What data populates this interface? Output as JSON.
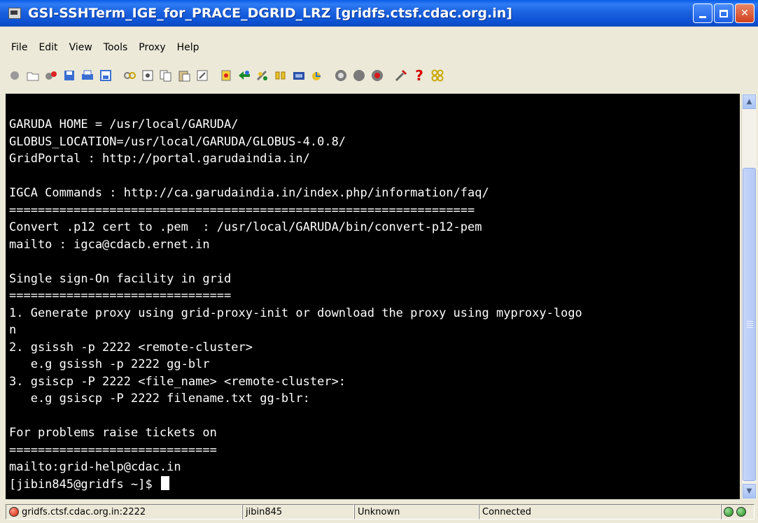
{
  "window": {
    "title": "GSI-SSHTerm_IGE_for_PRACE_DGRID_LRZ [gridfs.ctsf.cdac.org.in]",
    "minimize": "",
    "maximize": "",
    "close": "✕"
  },
  "menu": [
    "File",
    "Edit",
    "View",
    "Tools",
    "Proxy",
    "Help"
  ],
  "toolbar_icons": [
    "connect-icon",
    "open-icon",
    "disconnect-icon",
    "save-icon",
    "print-icon",
    "print-preview-icon",
    "properties-icon",
    "settings-icon",
    "copy-icon",
    "paste-icon",
    "edit-icon",
    "record-icon",
    "network-icon",
    "tools-icon",
    "keys-icon",
    "proxy-icon",
    "sftp-icon",
    "back-icon",
    "stop-icon",
    "record-dot-icon",
    "wrench-icon",
    "help-icon",
    "about-icon"
  ],
  "terminal": {
    "lines": [
      "GARUDA HOME = /usr/local/GARUDA/",
      "GLOBUS_LOCATION=/usr/local/GARUDA/GLOBUS-4.0.8/",
      "GridPortal : http://portal.garudaindia.in/",
      "",
      "IGCA Commands : http://ca.garudaindia.in/index.php/information/faq/",
      "=================================================================",
      "Convert .p12 cert to .pem  : /usr/local/GARUDA/bin/convert-p12-pem",
      "mailto : igca@cdacb.ernet.in",
      "",
      "Single sign-On facility in grid",
      "===============================",
      "1. Generate proxy using grid-proxy-init or download the proxy using myproxy-logo",
      "n",
      "2. gsissh -p 2222 <remote-cluster>",
      "   e.g gsissh -p 2222 gg-blr",
      "3. gsiscp -P 2222 <file_name> <remote-cluster>:",
      "   e.g gsiscp -P 2222 filename.txt gg-blr:",
      "",
      "For problems raise tickets on",
      "=============================",
      "mailto:grid-help@cdac.in"
    ],
    "prompt": "[jibin845@gridfs ~]$ "
  },
  "status": {
    "host": "gridfs.ctsf.cdac.org.in:2222",
    "user": "jibin845",
    "terminal_type": "Unknown",
    "connection": "Connected"
  }
}
